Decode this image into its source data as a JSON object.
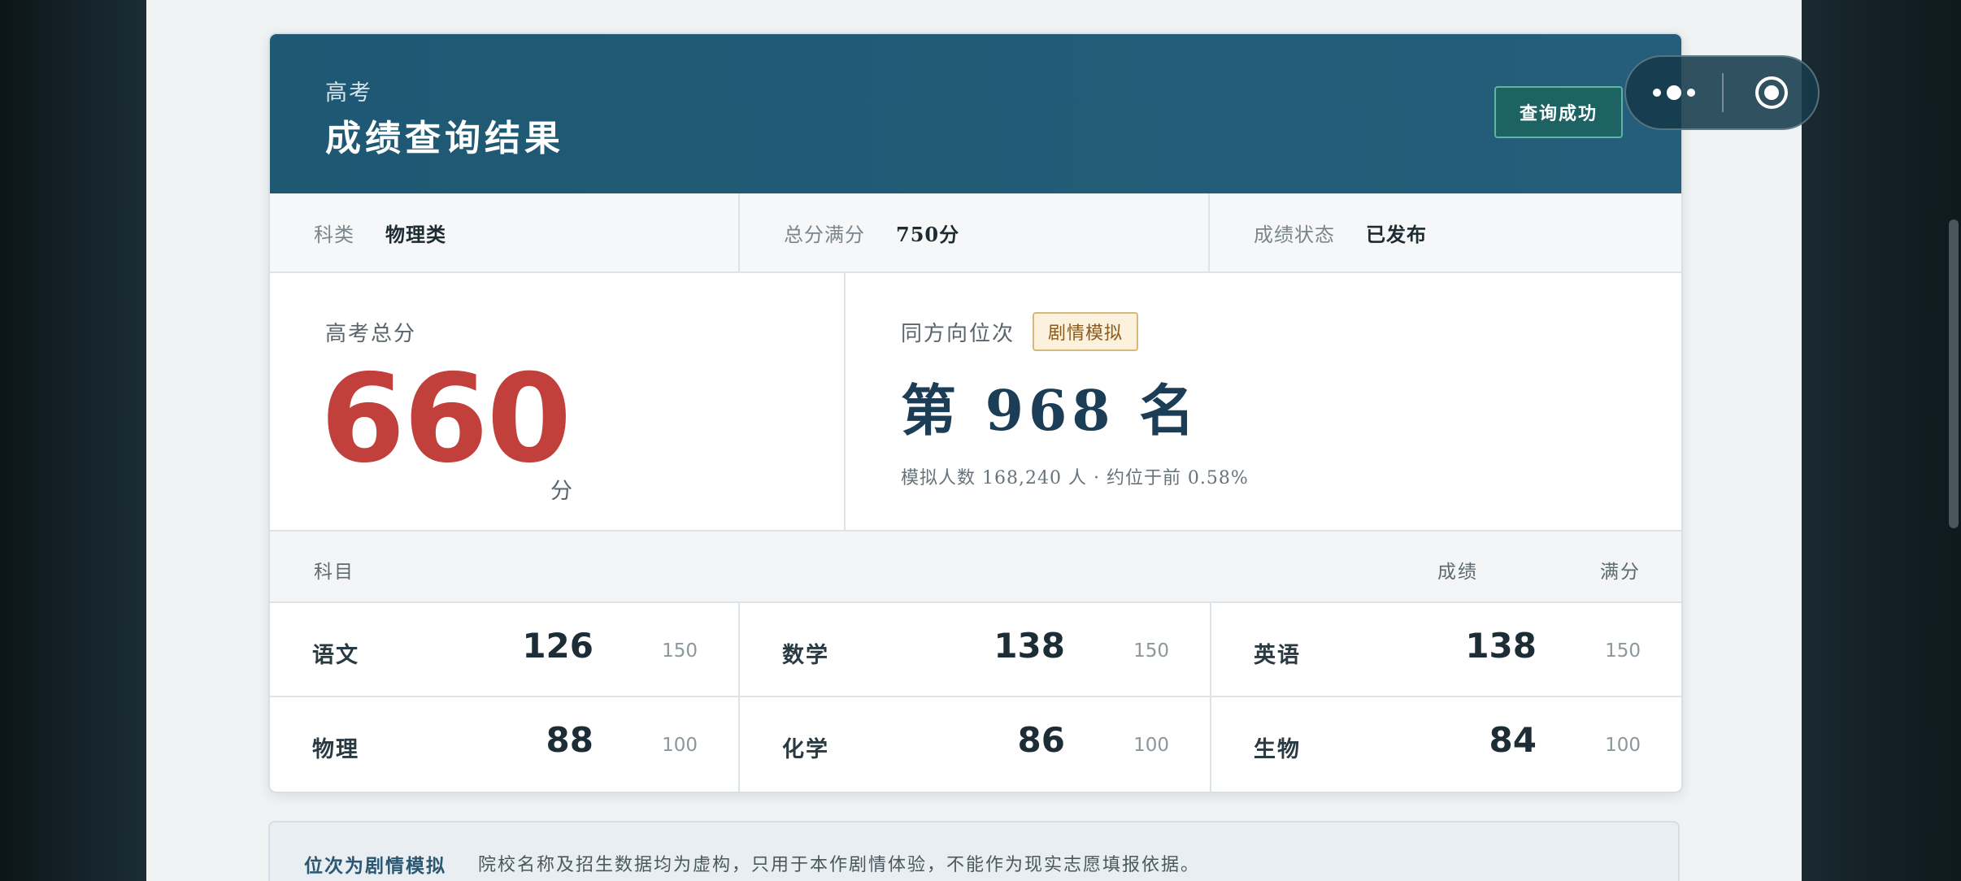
{
  "header": {
    "subtitle": "高考",
    "title": "成绩查询结果",
    "status_button": "查询成功"
  },
  "info": [
    {
      "label": "科类",
      "value": "物理类"
    },
    {
      "label": "总分满分",
      "value": "750分"
    },
    {
      "label": "成绩状态",
      "value": "已发布"
    }
  ],
  "total": {
    "label": "高考总分",
    "score": "660",
    "unit": "分"
  },
  "rank": {
    "label": "同方向位次",
    "tag": "剧情模拟",
    "value": "第 968 名",
    "note": "模拟人数 168,240 人 · 约位于前 0.58%"
  },
  "subjects_header": {
    "subject": "科目",
    "score": "成绩",
    "full": "满分"
  },
  "subjects": [
    {
      "name": "语文",
      "score": "126",
      "full": "150"
    },
    {
      "name": "数学",
      "score": "138",
      "full": "150"
    },
    {
      "name": "英语",
      "score": "138",
      "full": "150"
    },
    {
      "name": "物理",
      "score": "88",
      "full": "100"
    },
    {
      "name": "化学",
      "score": "86",
      "full": "100"
    },
    {
      "name": "生物",
      "score": "84",
      "full": "100"
    }
  ],
  "notice": {
    "title": "位次为剧情模拟",
    "text": "院校名称及招生数据均为虚构，只用于本作剧情体验，不能作为现实志愿填报依据。"
  },
  "capsule": {
    "more_icon": "more-dots-icon",
    "close_icon": "target-circle-icon"
  },
  "colors": {
    "header_bg": "#245e7a",
    "score_red": "#c1403b",
    "rank_navy": "#1b3d55",
    "success_green": "#1d6364",
    "tag_bg": "#fbf1dc"
  }
}
